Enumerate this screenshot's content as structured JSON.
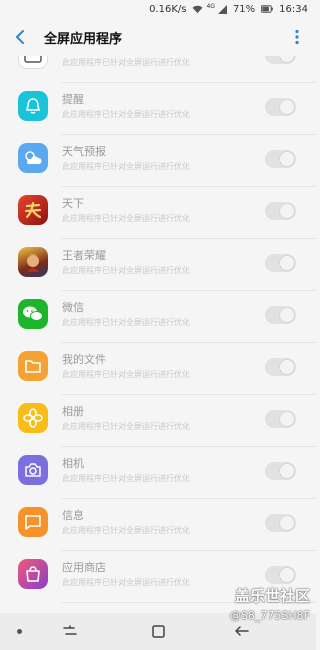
{
  "status_bar": {
    "speed": "0.16K/s",
    "network": "4G",
    "battery": "71%",
    "time": "16:34"
  },
  "header": {
    "title": "全屏应用程序"
  },
  "apps": [
    {
      "name": "",
      "desc": "此应用程序已针对全屏运行进行优化",
      "icon": "calendar-icon",
      "color": "#ffffff",
      "enabled": false
    },
    {
      "name": "提醒",
      "desc": "此应用程序已针对全屏运行进行优化",
      "icon": "reminder-icon",
      "color": "#19c3d8",
      "enabled": false
    },
    {
      "name": "天气预报",
      "desc": "此应用程序已针对全屏运行进行优化",
      "icon": "weather-icon",
      "color": "#5aa8f0",
      "enabled": false
    },
    {
      "name": "天下",
      "desc": "此应用程序已针对全屏运行进行优化",
      "icon": "tianxia-game-icon",
      "color": "#c8261e",
      "enabled": false
    },
    {
      "name": "王者荣耀",
      "desc": "此应用程序已针对全屏运行进行优化",
      "icon": "honor-of-kings-icon",
      "color": "#d99a2b",
      "enabled": false
    },
    {
      "name": "微信",
      "desc": "此应用程序已针对全屏运行进行优化",
      "icon": "wechat-icon",
      "color": "#1db52b",
      "enabled": false
    },
    {
      "name": "我的文件",
      "desc": "此应用程序已针对全屏运行进行优化",
      "icon": "folder-icon",
      "color": "#f5a235",
      "enabled": false
    },
    {
      "name": "相册",
      "desc": "此应用程序已针对全屏运行进行优化",
      "icon": "gallery-flower-icon",
      "color": "#f8bd16",
      "enabled": false
    },
    {
      "name": "相机",
      "desc": "此应用程序已针对全屏运行进行优化",
      "icon": "camera-icon",
      "color": "#7b6fe0",
      "enabled": false
    },
    {
      "name": "信息",
      "desc": "此应用程序已针对全屏运行进行优化",
      "icon": "message-icon",
      "color": "#f5932a",
      "enabled": false
    },
    {
      "name": "应用商店",
      "desc": "此应用程序已针对全屏运行进行优化",
      "icon": "app-store-bag-icon",
      "color": "#d2418e",
      "enabled": false
    }
  ],
  "watermark": {
    "title": "盖乐世社区",
    "user": "@S8_775SH8F"
  }
}
